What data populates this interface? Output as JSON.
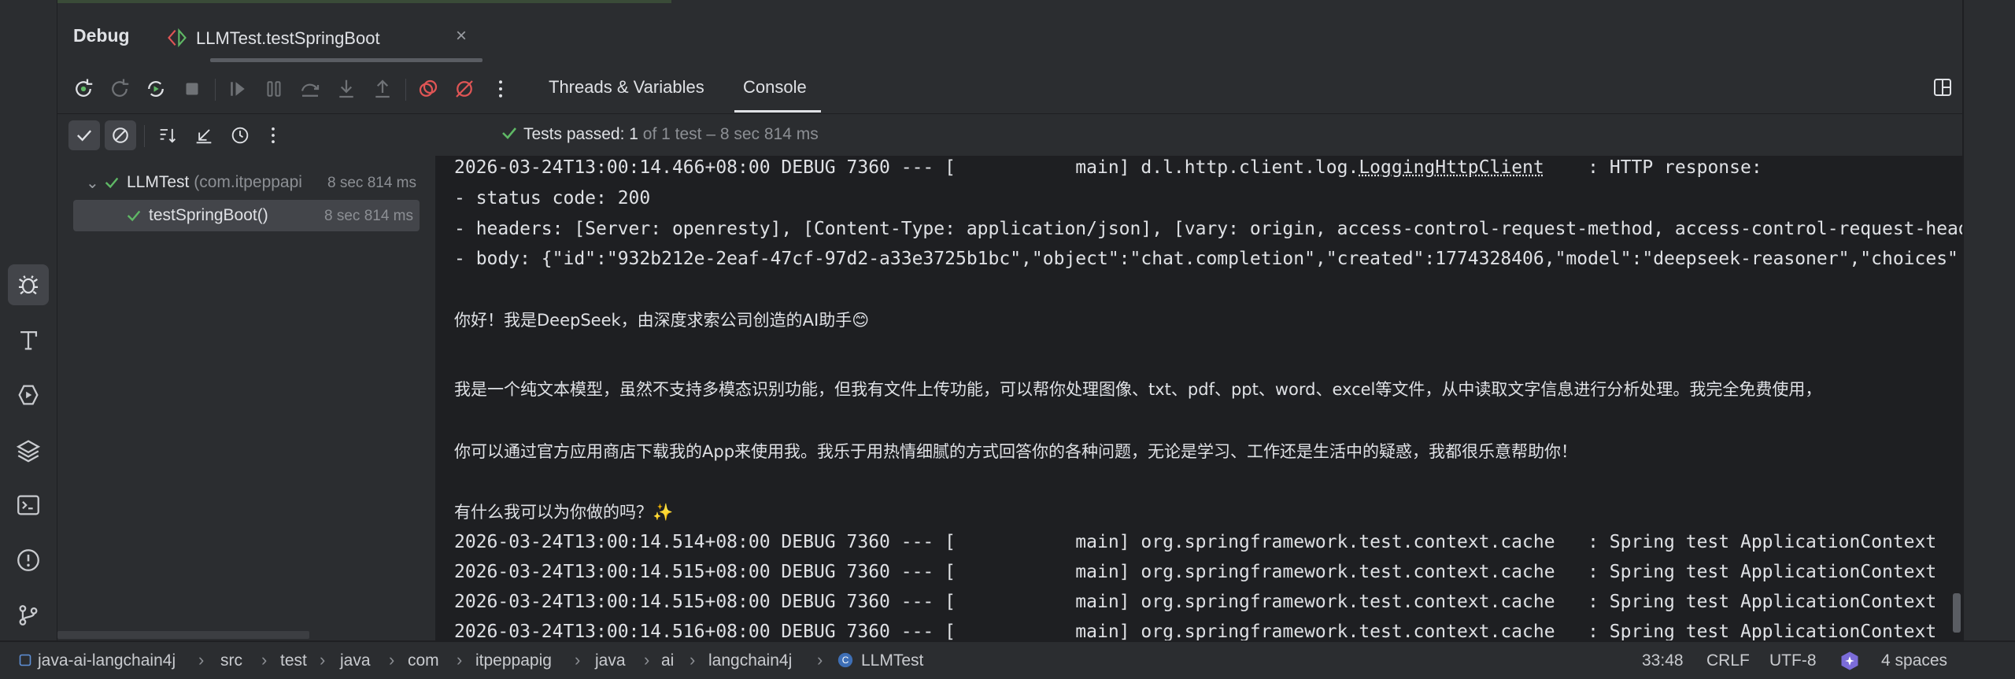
{
  "left_strip": {
    "icons": [
      "debug-icon",
      "build-icon",
      "run-services-icon",
      "layers-icon",
      "terminal-icon",
      "problems-icon",
      "git-icon"
    ]
  },
  "tab_header": {
    "title": "Debug",
    "run_tab_label": "LLMTest.testSpringBoot",
    "close_glyph": "×"
  },
  "toolbar": {
    "panel_tabs": [
      "Threads & Variables",
      "Console"
    ],
    "active_tab": "Console"
  },
  "status": {
    "passed_label": "Tests passed:",
    "passed_count": "1",
    "detail": "of 1 test – 8 sec 814 ms"
  },
  "tree": {
    "root_name": "LLMTest",
    "root_pkg": "(com.itpeppapi",
    "root_time": "8 sec 814 ms",
    "child_name": "testSpringBoot()",
    "child_time": "8 sec 814 ms"
  },
  "console": {
    "lines": [
      {
        "pre": "2026-03-24T13:00:14.466+08:00 DEBUG 7360 --- [           main] d.l.http.client.log.",
        "link": "LoggingHttpClient",
        "post": "    : HTTP response:"
      },
      {
        "pre": "- status code: 200"
      },
      {
        "pre": "- headers: [Server: openresty], [Content-Type: application/json], [vary: origin, access-control-request-method, access-control-request-headers]"
      },
      {
        "pre": "- body: {\"id\":\"932b212e-2eaf-47cf-97d2-a33e3725b1bc\",\"object\":\"chat.completion\",\"created\":1774328406,\"model\":\"deepseek-reasoner\",\"choices\""
      },
      {
        "pre": ""
      },
      {
        "pre": "你好！我是DeepSeek，由深度求索公司创造的AI助手😊",
        "cn": true
      },
      {
        "pre": ""
      },
      {
        "pre": "我是一个纯文本模型，虽然不支持多模态识别功能，但我有文件上传功能，可以帮你处理图像、txt、pdf、ppt、word、excel等文件，从中读取文字信息进行分析处理。我完全免费使用，",
        "cn": true
      },
      {
        "pre": ""
      },
      {
        "pre": "你可以通过官方应用商店下载我的App来使用我。我乐于用热情细腻的方式回答你的各种问题，无论是学习、工作还是生活中的疑惑，我都很乐意帮助你！",
        "cn": true
      },
      {
        "pre": ""
      },
      {
        "pre": "有什么我可以为你做的吗？✨",
        "cn": true
      },
      {
        "pre": "2026-03-24T13:00:14.514+08:00 DEBUG 7360 --- [           main] org.springframework.test.context.cache   : Spring test ApplicationContext"
      },
      {
        "pre": "2026-03-24T13:00:14.515+08:00 DEBUG 7360 --- [           main] org.springframework.test.context.cache   : Spring test ApplicationContext"
      },
      {
        "pre": "2026-03-24T13:00:14.515+08:00 DEBUG 7360 --- [           main] org.springframework.test.context.cache   : Spring test ApplicationContext"
      },
      {
        "pre": "2026-03-24T13:00:14.516+08:00 DEBUG 7360 --- [           main] org.springframework.test.context.cache   : Spring test ApplicationContext"
      }
    ]
  },
  "breadcrumb": {
    "items": [
      "java-ai-langchain4j",
      "src",
      "test",
      "java",
      "com",
      "itpeppapig",
      "java",
      "ai",
      "langchain4j",
      "LLMTest"
    ],
    "separator": "›"
  },
  "status_bar": {
    "position": "33:48",
    "line_ending": "CRLF",
    "encoding": "UTF-8",
    "indent": "4 spaces"
  },
  "colors": {
    "pass_green": "#5fb865",
    "debug_green": "#5fb865",
    "breakpoint_red": "#e05555",
    "background": "#1e1f22",
    "panel": "#2b2d30"
  }
}
